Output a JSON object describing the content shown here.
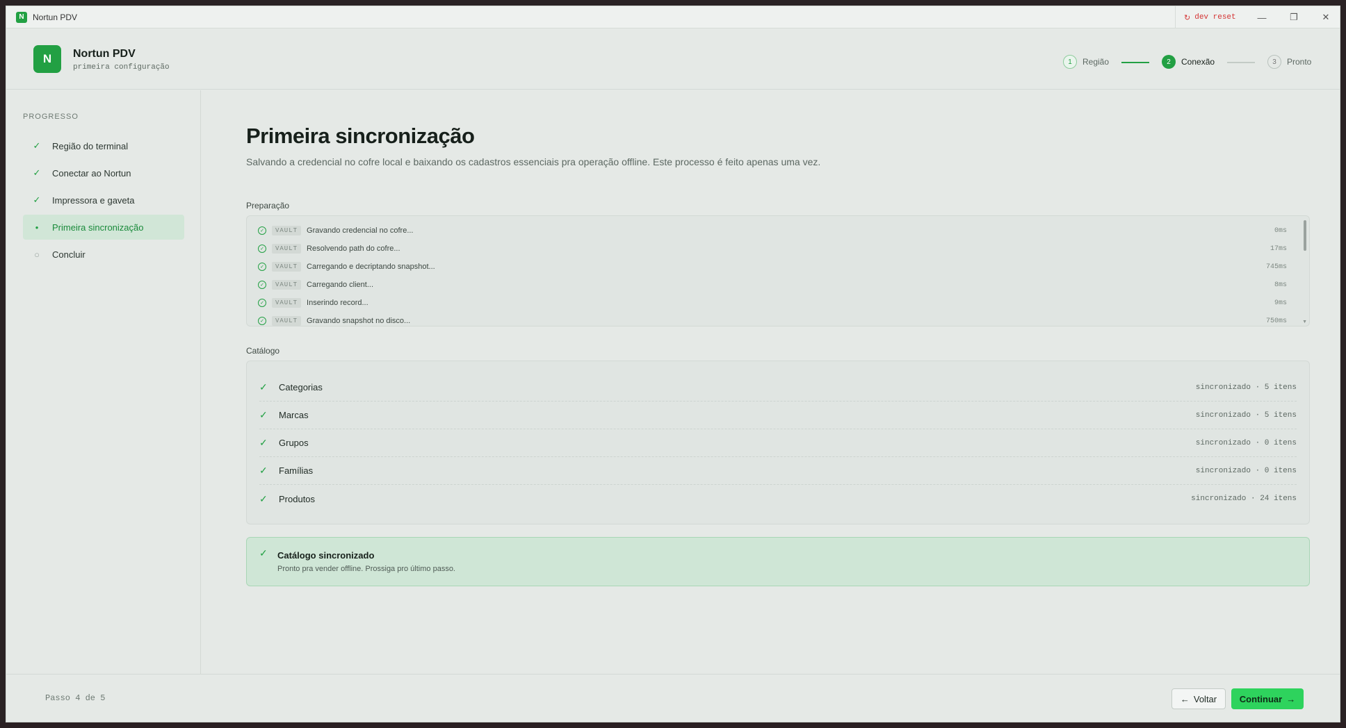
{
  "window": {
    "app_icon_letter": "N",
    "title": "Nortun PDV",
    "dev_reset_label": "dev reset",
    "minimize": "—",
    "maximize": "❐",
    "close": "✕"
  },
  "header": {
    "logo_letter": "N",
    "brand_name": "Nortun PDV",
    "brand_subtitle": "primeira configuração",
    "steps": [
      {
        "number": "1",
        "label": "Região",
        "state": "done"
      },
      {
        "number": "2",
        "label": "Conexão",
        "state": "active"
      },
      {
        "number": "3",
        "label": "Pronto",
        "state": "pending"
      }
    ]
  },
  "sidebar": {
    "heading": "PROGRESSO",
    "items": [
      {
        "label": "Região do terminal",
        "icon": "✓",
        "state": "done"
      },
      {
        "label": "Conectar ao Nortun",
        "icon": "✓",
        "state": "done"
      },
      {
        "label": "Impressora e gaveta",
        "icon": "✓",
        "state": "done"
      },
      {
        "label": "Primeira sincronização",
        "icon": "•",
        "state": "active"
      },
      {
        "label": "Concluir",
        "icon": "○",
        "state": "pending"
      }
    ]
  },
  "main": {
    "title": "Primeira sincronização",
    "description": "Salvando a credencial no cofre local e baixando os cadastros essenciais pra operação offline. Este processo é feito apenas uma vez.",
    "prep_label": "Preparação",
    "prep_log": [
      {
        "tag": "VAULT",
        "text": "Gravando credencial no cofre...",
        "time": "0ms"
      },
      {
        "tag": "VAULT",
        "text": "Resolvendo path do cofre...",
        "time": "17ms"
      },
      {
        "tag": "VAULT",
        "text": "Carregando e decriptando snapshot...",
        "time": "745ms"
      },
      {
        "tag": "VAULT",
        "text": "Carregando client...",
        "time": "8ms"
      },
      {
        "tag": "VAULT",
        "text": "Inserindo record...",
        "time": "9ms"
      },
      {
        "tag": "VAULT",
        "text": "Gravando snapshot no disco...",
        "time": "750ms"
      }
    ],
    "catalog_label": "Catálogo",
    "catalog": [
      {
        "name": "Categorias",
        "status": "sincronizado · 5 itens"
      },
      {
        "name": "Marcas",
        "status": "sincronizado · 5 itens"
      },
      {
        "name": "Grupos",
        "status": "sincronizado · 0 itens"
      },
      {
        "name": "Famílias",
        "status": "sincronizado · 0 itens"
      },
      {
        "name": "Produtos",
        "status": "sincronizado · 24 itens"
      }
    ],
    "success_title": "Catálogo sincronizado",
    "success_subtitle": "Pronto pra vender offline. Prossiga pro último passo."
  },
  "footer": {
    "step_counter": "Passo 4 de 5",
    "back_label": "Voltar",
    "continue_label": "Continuar"
  },
  "colors": {
    "accent": "#22a043",
    "continue_bg": "#2ed35d",
    "danger": "#d43434",
    "background": "#e5e9e6"
  }
}
